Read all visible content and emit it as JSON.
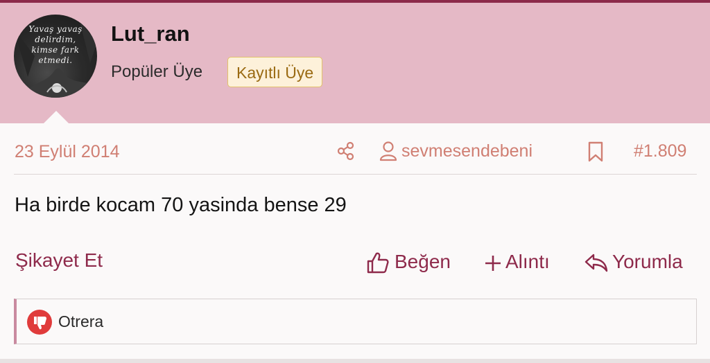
{
  "colors": {
    "brand": "#8c2a4a",
    "header_bg": "#e5b9c6",
    "meta_text": "#d07f73",
    "action_text": "#8e2a4b",
    "badge_bg": "#fdf1da",
    "badge_border": "#e2c26a",
    "dislike_red": "#e03b3b"
  },
  "author_card": {
    "avatar_lines": [
      "Yavaş yavaş",
      "delirdim,",
      "kimse fark",
      "etmedi."
    ],
    "username": "Lut_ran",
    "user_title": "Popüler Üye",
    "badge": "Kayıtlı Üye"
  },
  "post_meta": {
    "date": "23 Eylül 2014",
    "share_icon": "share-icon",
    "quoted_user_icon": "user-icon",
    "quoted_user": "sevmesendebeni",
    "bookmark_icon": "bookmark-icon",
    "post_number": "#1.809"
  },
  "post": {
    "body": "Ha birde kocam 70 yasinda bense 29"
  },
  "actions": {
    "report": "Şikayet Et",
    "like": "Beğen",
    "quote": "Alıntı",
    "reply": "Yorumla",
    "like_icon": "thumbs-up-icon",
    "quote_icon": "plus-icon",
    "reply_icon": "reply-icon"
  },
  "reactions": {
    "icon": "thumbs-down-icon",
    "users": "Otrera"
  }
}
